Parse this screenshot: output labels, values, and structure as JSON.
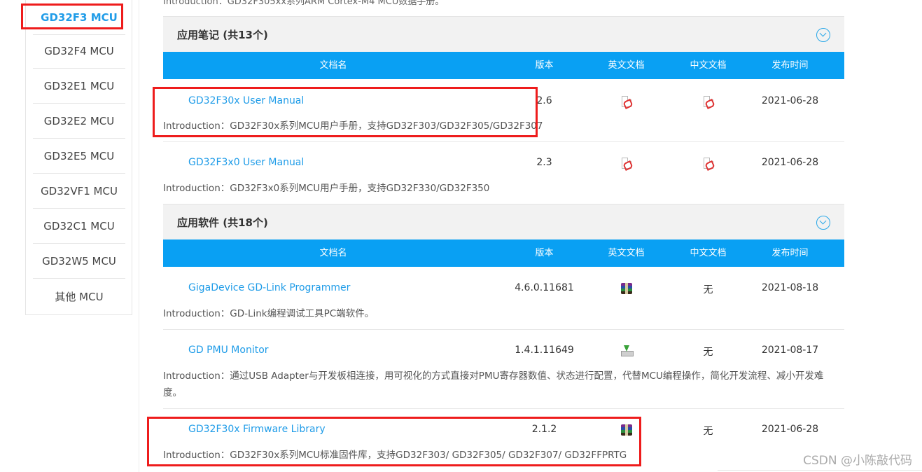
{
  "sidebar": {
    "items": [
      {
        "label": "GD32F3  MCU",
        "active": true
      },
      {
        "label": "GD32F4  MCU"
      },
      {
        "label": "GD32E1  MCU"
      },
      {
        "label": "GD32E2  MCU"
      },
      {
        "label": "GD32E5  MCU"
      },
      {
        "label": "GD32VF1  MCU"
      },
      {
        "label": "GD32C1  MCU"
      },
      {
        "label": "GD32W5  MCU"
      },
      {
        "label": "其他  MCU"
      }
    ]
  },
  "top_intro": "Introduction：GD32F305xx系列ARM Cortex-M4 MCU数据手册。",
  "columns": {
    "name": "文档名",
    "version": "版本",
    "en_doc": "英文文档",
    "cn_doc": "中文文档",
    "date": "发布时间"
  },
  "sections": [
    {
      "title": "应用笔记 (共13个)",
      "rows": [
        {
          "name": "GD32F30x User Manual",
          "version": "2.6",
          "en_icon": "pdf-icon",
          "cn_icon": "pdf-icon",
          "date": "2021-06-28",
          "intro": "Introduction：GD32F30x系列MCU用户手册，支持GD32F303/GD32F305/GD32F307"
        },
        {
          "name": "GD32F3x0 User Manual",
          "version": "2.3",
          "en_icon": "pdf-icon",
          "cn_icon": "pdf-icon",
          "date": "2021-06-28",
          "intro": "Introduction：GD32F3x0系列MCU用户手册，支持GD32F330/GD32F350"
        }
      ]
    },
    {
      "title": "应用软件 (共18个)",
      "rows": [
        {
          "name": "GigaDevice GD-Link Programmer",
          "version": "4.6.0.11681",
          "en_icon": "rar-icon",
          "cn_text": "无",
          "date": "2021-08-18",
          "intro": "Introduction：GD-Link编程调试工具PC端软件。"
        },
        {
          "name": "GD PMU Monitor",
          "version": "1.4.1.11649",
          "en_icon": "download-icon",
          "cn_text": "无",
          "date": "2021-08-17",
          "intro": "Introduction：通过USB Adapter与开发板相连接，用可视化的方式直接对PMU寄存器数值、状态进行配置，代替MCU编程操作，简化开发流程、减小开发难度。"
        },
        {
          "name": "GD32F30x Firmware Library",
          "version": "2.1.2",
          "en_icon": "rar-icon",
          "cn_text": "无",
          "date": "2021-06-28",
          "intro": "Introduction：GD32F30x系列MCU标准固件库，支持GD32F303/ GD32F305/ GD32F307/ GD32FFPRTG"
        }
      ]
    }
  ],
  "watermark": "CSDN @小陈敲代码",
  "colors": {
    "accent": "#09a0f3",
    "link": "#1f9ce8",
    "highlight": "#ee1c1c"
  }
}
